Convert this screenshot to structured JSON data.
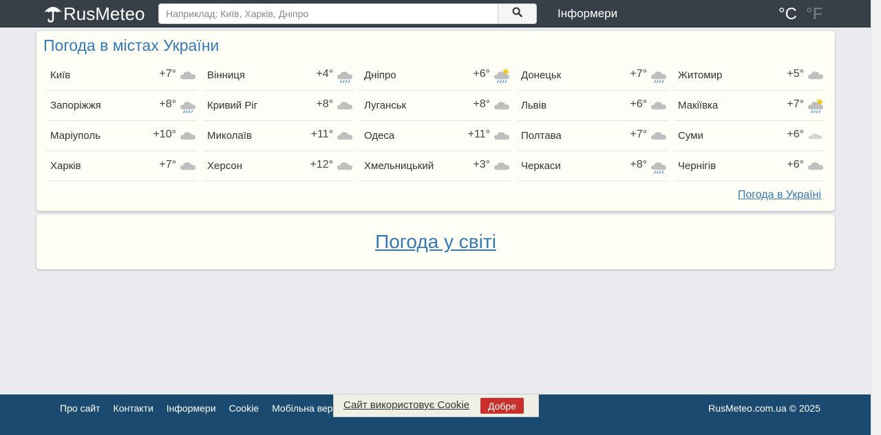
{
  "header": {
    "logo_text": "RusMeteo",
    "search_placeholder": "Наприклад: Київ, Харків, Дніпро",
    "informers_label": "Інформери",
    "unit_c": "°C",
    "unit_f": "°F"
  },
  "cities_panel": {
    "title": "Погода в містах України",
    "link": "Погода в Україні",
    "cities": [
      {
        "name": "Київ",
        "temp": "+7°",
        "icon": "cloudy"
      },
      {
        "name": "Вінниця",
        "temp": "+4°",
        "icon": "rain"
      },
      {
        "name": "Дніпро",
        "temp": "+6°",
        "icon": "sun-rain"
      },
      {
        "name": "Донецьк",
        "temp": "+7°",
        "icon": "rain"
      },
      {
        "name": "Житомир",
        "temp": "+5°",
        "icon": "cloudy"
      },
      {
        "name": "Запоріжжя",
        "temp": "+8°",
        "icon": "rain"
      },
      {
        "name": "Кривий Ріг",
        "temp": "+8°",
        "icon": "cloudy"
      },
      {
        "name": "Луганськ",
        "temp": "+8°",
        "icon": "cloudy"
      },
      {
        "name": "Львів",
        "temp": "+6°",
        "icon": "cloudy"
      },
      {
        "name": "Макіївка",
        "temp": "+7°",
        "icon": "sun-rain"
      },
      {
        "name": "Маріуполь",
        "temp": "+10°",
        "icon": "cloudy"
      },
      {
        "name": "Миколаїв",
        "temp": "+11°",
        "icon": "cloudy"
      },
      {
        "name": "Одеса",
        "temp": "+11°",
        "icon": "cloudy"
      },
      {
        "name": "Полтава",
        "temp": "+7°",
        "icon": "cloudy"
      },
      {
        "name": "Суми",
        "temp": "+6°",
        "icon": "light-cloud"
      },
      {
        "name": "Харків",
        "temp": "+7°",
        "icon": "cloudy"
      },
      {
        "name": "Херсон",
        "temp": "+12°",
        "icon": "cloudy"
      },
      {
        "name": "Хмельницький",
        "temp": "+3°",
        "icon": "cloudy"
      },
      {
        "name": "Черкаси",
        "temp": "+8°",
        "icon": "rain"
      },
      {
        "name": "Чернігів",
        "temp": "+6°",
        "icon": "cloudy"
      }
    ]
  },
  "world_panel": {
    "link": "Погода у світі"
  },
  "footer": {
    "links": [
      "Про сайт",
      "Контакти",
      "Інформери",
      "Cookie",
      "Мобільна версія"
    ],
    "copyright": "RusMeteo.com.ua © 2025"
  },
  "cookie_bar": {
    "text": "Сайт використовує Cookie",
    "button": "Добре"
  },
  "colors": {
    "header_bg": "#374048",
    "link_blue": "#337ab7",
    "footer_bg": "#1b4a70",
    "cookie_button": "#c9302c"
  }
}
